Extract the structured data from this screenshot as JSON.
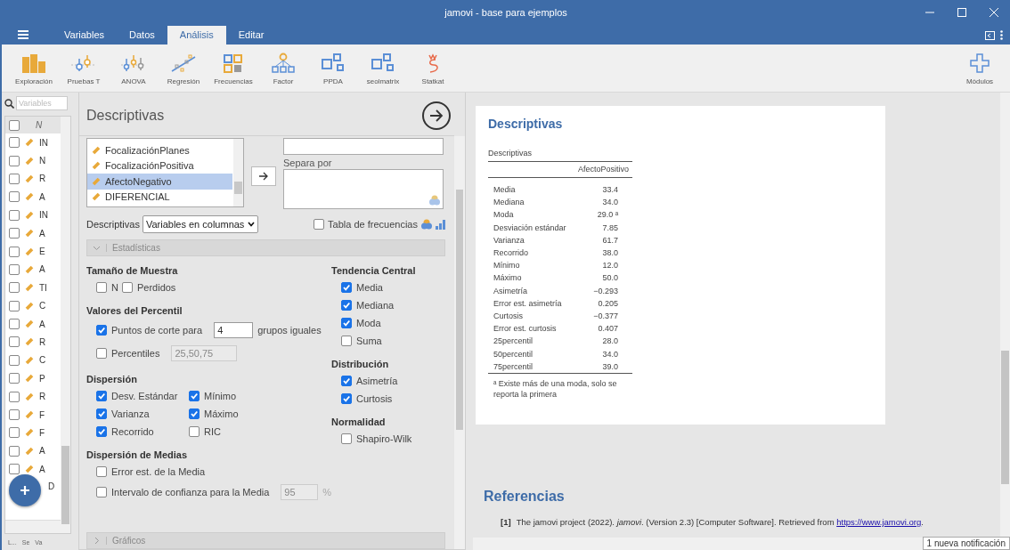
{
  "window": {
    "title": "jamovi - base para ejemplos"
  },
  "tabs": [
    {
      "label": "Variables",
      "selected": false
    },
    {
      "label": "Datos",
      "selected": false
    },
    {
      "label": "Análisis",
      "selected": true
    },
    {
      "label": "Editar",
      "selected": false
    }
  ],
  "ribbon": [
    {
      "label": "Exploración",
      "kind": "bars"
    },
    {
      "label": "Pruebas T",
      "kind": "ttest"
    },
    {
      "label": "ANOVA",
      "kind": "anova"
    },
    {
      "label": "Regresión",
      "kind": "regression"
    },
    {
      "label": "Frecuencias",
      "kind": "grid"
    },
    {
      "label": "Factor",
      "kind": "tree"
    },
    {
      "label": "PPDA",
      "kind": "squares"
    },
    {
      "label": "seolmatrix",
      "kind": "squares"
    },
    {
      "label": "Statkat",
      "kind": "squiggle"
    }
  ],
  "modules": {
    "label": "Módulos"
  },
  "variables_pane": {
    "search": {
      "placeholder": "Variables"
    },
    "header": "N",
    "rows": [
      {
        "name": "IN",
        "checked": false
      },
      {
        "name": "N",
        "checked": false
      },
      {
        "name": "R",
        "checked": false
      },
      {
        "name": "A",
        "checked": false
      },
      {
        "name": "IN",
        "checked": false
      },
      {
        "name": "A",
        "checked": false
      },
      {
        "name": "E",
        "checked": false
      },
      {
        "name": "A",
        "checked": false
      },
      {
        "name": "TI",
        "checked": false
      },
      {
        "name": "C",
        "checked": false
      },
      {
        "name": "A",
        "checked": false
      },
      {
        "name": "R",
        "checked": false
      },
      {
        "name": "C",
        "checked": false
      },
      {
        "name": "P",
        "checked": false
      },
      {
        "name": "R",
        "checked": false
      },
      {
        "name": "F",
        "checked": false
      },
      {
        "name": "F",
        "checked": false
      },
      {
        "name": "A",
        "checked": false
      },
      {
        "name": "A",
        "checked": false
      },
      {
        "name": "D"
      }
    ],
    "select_all_checked": false,
    "footer": [
      "L...",
      "Se",
      "Va"
    ]
  },
  "options": {
    "title": "Descriptivas",
    "source_variables": [
      {
        "name": "FocalizaciónPlanes",
        "selected": false
      },
      {
        "name": "FocalizaciónPositiva",
        "selected": false
      },
      {
        "name": "AfectoNegativo",
        "selected": true
      },
      {
        "name": "DIFERENCIAL",
        "selected": false
      }
    ],
    "split_label": "Separa por",
    "layout_label": "Descriptivas",
    "layout_value": "Variables en columnas",
    "frequency_table": {
      "label": "Tabla de frecuencias",
      "checked": false
    },
    "statistics_section": {
      "title": "Estadísticas",
      "expanded": true
    },
    "columns": [
      {
        "groups": [
          {
            "title": "Tamaño de Muestra",
            "kind": "inline",
            "items": [
              {
                "label": "N",
                "checked": false
              },
              {
                "label": "Perdidos",
                "checked": false
              }
            ]
          },
          {
            "title": "Valores del Percentil",
            "kind": "stack",
            "items": [
              {
                "label": "Puntos de corte para",
                "checked": true,
                "value": "4",
                "field_disabled": false,
                "suffix": "grupos iguales"
              },
              {
                "label": "Percentiles",
                "checked": false,
                "value": "25,50,75",
                "field_disabled": true
              }
            ]
          },
          {
            "title": "Dispersión",
            "kind": "grid",
            "items": [
              {
                "label": "Desv. Estándar",
                "checked": true
              },
              {
                "label": "Mínimo",
                "checked": true
              },
              {
                "label": "Varianza",
                "checked": true
              },
              {
                "label": "Máximo",
                "checked": true
              },
              {
                "label": "Recorrido",
                "checked": true
              },
              {
                "label": "RIC",
                "checked": false
              }
            ]
          },
          {
            "title": "Dispersión de Medias",
            "kind": "stack",
            "items": [
              {
                "label": "Error est. de la Media",
                "checked": false
              },
              {
                "label": "Intervalo de confianza para la Media",
                "checked": false,
                "value": "95",
                "field_disabled": true,
                "suffix": "%"
              }
            ]
          }
        ]
      },
      {
        "groups": [
          {
            "title": "Tendencia Central",
            "kind": "stack",
            "items": [
              {
                "label": "Media",
                "checked": true
              },
              {
                "label": "Mediana",
                "checked": true
              },
              {
                "label": "Moda",
                "checked": true
              },
              {
                "label": "Suma",
                "checked": false
              }
            ]
          },
          {
            "title": "Distribución",
            "kind": "stack",
            "items": [
              {
                "label": "Asimetría",
                "checked": true
              },
              {
                "label": "Curtosis",
                "checked": true
              }
            ]
          },
          {
            "title": "Normalidad",
            "kind": "stack",
            "items": [
              {
                "label": "Shapiro-Wilk",
                "checked": false
              }
            ]
          }
        ]
      }
    ],
    "plots_section": {
      "title": "Gráficos",
      "expanded": false
    }
  },
  "results": {
    "title": "Descriptivas",
    "table_caption": "Descriptivas",
    "column": "AfectoPositivo",
    "rows": [
      {
        "label": "Media",
        "value": "33.4"
      },
      {
        "label": "Mediana",
        "value": "34.0"
      },
      {
        "label": "Moda",
        "value": "29.0 ᵃ"
      },
      {
        "label": "Desviación estándar",
        "value": "7.85"
      },
      {
        "label": "Varianza",
        "value": "61.7"
      },
      {
        "label": "Recorrido",
        "value": "38.0"
      },
      {
        "label": "Mínimo",
        "value": "12.0"
      },
      {
        "label": "Máximo",
        "value": "50.0"
      },
      {
        "label": "Asimetría",
        "value": "−0.293"
      },
      {
        "label": "Error est. asimetría",
        "value": "0.205"
      },
      {
        "label": "Curtosis",
        "value": "−0.377"
      },
      {
        "label": "Error est. curtosis",
        "value": "0.407"
      },
      {
        "label": "25percentil",
        "value": "28.0"
      },
      {
        "label": "50percentil",
        "value": "34.0"
      },
      {
        "label": "75percentil",
        "value": "39.0"
      }
    ],
    "footnote": "ᵃ Existe más de una moda, solo se reporta la primera"
  },
  "references": {
    "title": "Referencias",
    "items": [
      {
        "number": "[1]",
        "text": "The jamovi project (2022). *jamovi*. (Version 2.3) [Computer Software]. Retrieved from",
        "link": "https://www.jamovi.org",
        "end": "."
      }
    ]
  },
  "notification": "1 nueva notificación"
}
